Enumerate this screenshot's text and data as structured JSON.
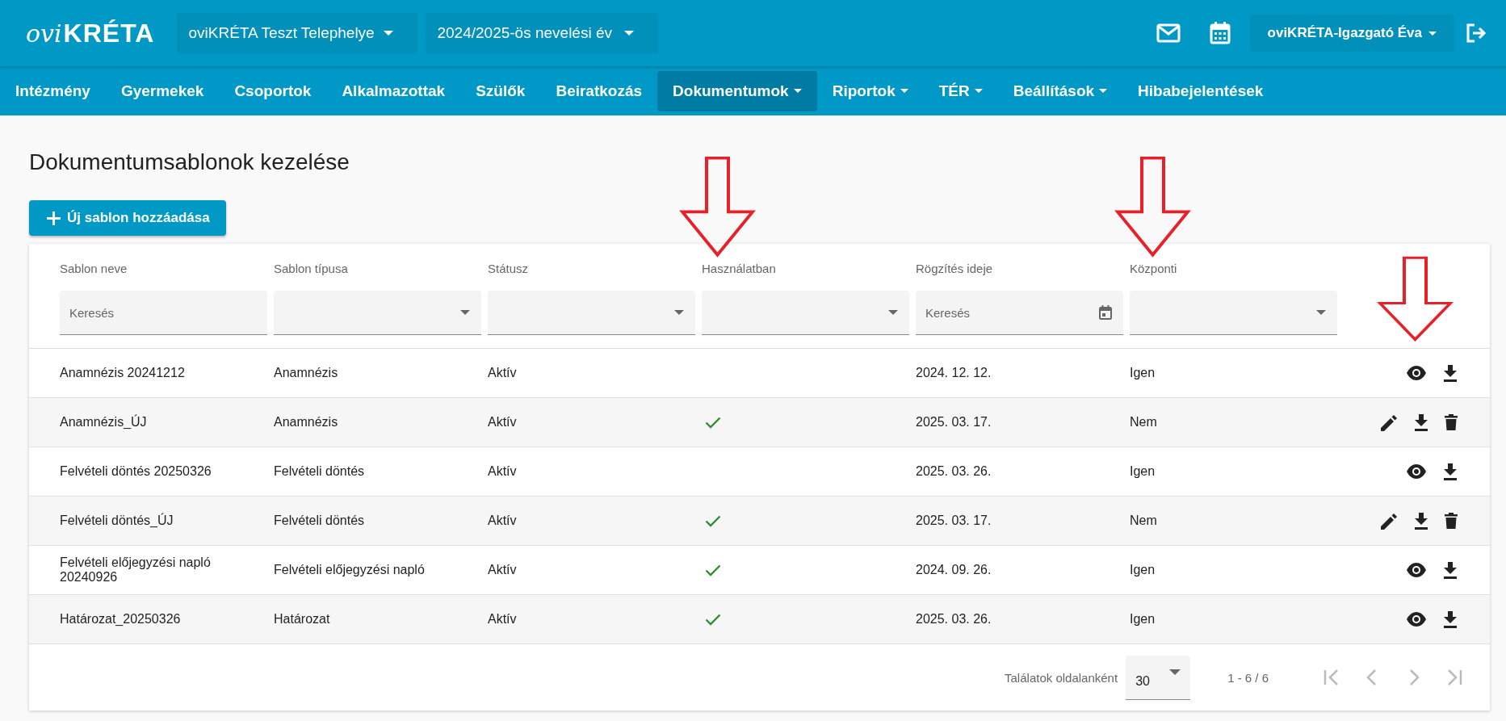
{
  "header": {
    "logo": {
      "script": "ovi",
      "word": "KRÉTA"
    },
    "site_select": "oviKRÉTA Teszt Telephelye",
    "year_select": "2024/2025-ös nevelési év",
    "user": "oviKRÉTA-Igazgató Éva"
  },
  "nav": [
    {
      "label": "Intézmény",
      "dropdown": false,
      "selected": false
    },
    {
      "label": "Gyermekek",
      "dropdown": false,
      "selected": false
    },
    {
      "label": "Csoportok",
      "dropdown": false,
      "selected": false
    },
    {
      "label": "Alkalmazottak",
      "dropdown": false,
      "selected": false
    },
    {
      "label": "Szülők",
      "dropdown": false,
      "selected": false
    },
    {
      "label": "Beiratkozás",
      "dropdown": false,
      "selected": false
    },
    {
      "label": "Dokumentumok",
      "dropdown": true,
      "selected": true
    },
    {
      "label": "Riportok",
      "dropdown": true,
      "selected": false
    },
    {
      "label": "TÉR",
      "dropdown": true,
      "selected": false
    },
    {
      "label": "Beállítások",
      "dropdown": true,
      "selected": false
    },
    {
      "label": "Hibabejelentések",
      "dropdown": false,
      "selected": false
    }
  ],
  "page_title": "Dokumentumsablonok kezelése",
  "add_button": "Új sablon hozzáadása",
  "table": {
    "columns": [
      {
        "label": "Sablon neve",
        "filter": {
          "kind": "text",
          "placeholder": "Keresés"
        }
      },
      {
        "label": "Sablon típusa",
        "filter": {
          "kind": "select"
        }
      },
      {
        "label": "Státusz",
        "filter": {
          "kind": "select"
        }
      },
      {
        "label": "Használatban",
        "filter": {
          "kind": "select"
        }
      },
      {
        "label": "Rögzítés ideje",
        "filter": {
          "kind": "date",
          "placeholder": "Keresés"
        }
      },
      {
        "label": "Központi",
        "filter": {
          "kind": "select"
        }
      }
    ],
    "rows": [
      {
        "name": "Anamnézis 20241212",
        "type": "Anamnézis",
        "status": "Aktív",
        "in_use": false,
        "date": "2024. 12. 12.",
        "central": "Igen",
        "actions": [
          {
            "kind": "view"
          },
          {
            "kind": "download"
          }
        ]
      },
      {
        "name": "Anamnézis_ÚJ",
        "type": "Anamnézis",
        "status": "Aktív",
        "in_use": true,
        "date": "2025. 03. 17.",
        "central": "Nem",
        "actions": [
          {
            "kind": "edit"
          },
          {
            "kind": "download"
          },
          {
            "kind": "delete"
          }
        ]
      },
      {
        "name": "Felvételi döntés 20250326",
        "type": "Felvételi döntés",
        "status": "Aktív",
        "in_use": false,
        "date": "2025. 03. 26.",
        "central": "Igen",
        "actions": [
          {
            "kind": "view"
          },
          {
            "kind": "download"
          }
        ]
      },
      {
        "name": "Felvételi döntés_ÚJ",
        "type": "Felvételi döntés",
        "status": "Aktív",
        "in_use": true,
        "date": "2025. 03. 17.",
        "central": "Nem",
        "actions": [
          {
            "kind": "edit"
          },
          {
            "kind": "download"
          },
          {
            "kind": "delete"
          }
        ]
      },
      {
        "name": "Felvételi előjegyzési napló 20240926",
        "type": "Felvételi előjegyzési napló",
        "status": "Aktív",
        "in_use": true,
        "date": "2024. 09. 26.",
        "central": "Igen",
        "actions": [
          {
            "kind": "view"
          },
          {
            "kind": "download"
          }
        ]
      },
      {
        "name": "Határozat_20250326",
        "type": "Határozat",
        "status": "Aktív",
        "in_use": true,
        "date": "2025. 03. 26.",
        "central": "Igen",
        "actions": [
          {
            "kind": "view"
          },
          {
            "kind": "download"
          }
        ]
      }
    ]
  },
  "pagination": {
    "per_page_label": "Találatok oldalanként",
    "per_page": "30",
    "range": "1 - 6 / 6",
    "buttons": [
      {
        "kind": "first",
        "disabled": true
      },
      {
        "kind": "prev",
        "disabled": true
      },
      {
        "kind": "next",
        "disabled": true
      },
      {
        "kind": "last",
        "disabled": true
      }
    ]
  }
}
